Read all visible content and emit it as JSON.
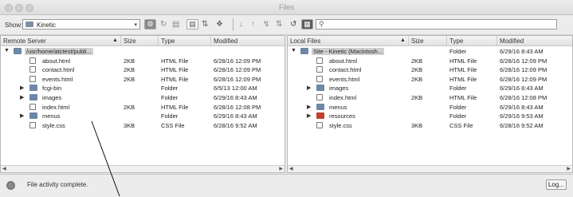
{
  "window": {
    "title": "Files"
  },
  "toolbar": {
    "show_label": "Show:",
    "site_value": "Kinetic",
    "search_value": ""
  },
  "left_pane": {
    "headers": {
      "name": "Remote Server",
      "size": "Size",
      "type": "Type",
      "modified": "Modified"
    },
    "rows": [
      {
        "name": "/usr/home/atctest/publi...",
        "size": "",
        "type": "",
        "modified": "",
        "kind": "folder",
        "level": 0,
        "expanded": true,
        "selected": true
      },
      {
        "name": "about.html",
        "size": "2KB",
        "type": "HTML File",
        "modified": "6/28/16 12:09 PM",
        "kind": "file",
        "level": 1
      },
      {
        "name": "contact.html",
        "size": "2KB",
        "type": "HTML File",
        "modified": "6/28/16 12:09 PM",
        "kind": "file",
        "level": 1
      },
      {
        "name": "events.html",
        "size": "2KB",
        "type": "HTML File",
        "modified": "6/28/16 12:09 PM",
        "kind": "file",
        "level": 1
      },
      {
        "name": "fcgi-bin",
        "size": "",
        "type": "Folder",
        "modified": "6/5/13 12:00 AM",
        "kind": "folder",
        "level": 1,
        "expanded": false
      },
      {
        "name": "images",
        "size": "",
        "type": "Folder",
        "modified": "6/29/16 8:43 AM",
        "kind": "folder",
        "level": 1,
        "expanded": false
      },
      {
        "name": "index.html",
        "size": "2KB",
        "type": "HTML File",
        "modified": "6/28/16 12:08 PM",
        "kind": "file",
        "level": 1
      },
      {
        "name": "menus",
        "size": "",
        "type": "Folder",
        "modified": "6/29/16 8:43 AM",
        "kind": "folder",
        "level": 1,
        "expanded": false
      },
      {
        "name": "style.css",
        "size": "3KB",
        "type": "CSS File",
        "modified": "6/28/16 9:52 AM",
        "kind": "file",
        "level": 1
      }
    ]
  },
  "right_pane": {
    "headers": {
      "name": "Local Files",
      "size": "Size",
      "type": "Type",
      "modified": "Modified"
    },
    "rows": [
      {
        "name": "Site - Kinetic (Macintosh...",
        "size": "",
        "type": "Folder",
        "modified": "6/29/16 8:43 AM",
        "kind": "folder",
        "level": 0,
        "expanded": true,
        "selected": true
      },
      {
        "name": "about.html",
        "size": "2KB",
        "type": "HTML File",
        "modified": "6/28/16 12:09 PM",
        "kind": "file",
        "level": 1
      },
      {
        "name": "contact.html",
        "size": "2KB",
        "type": "HTML File",
        "modified": "6/28/16 12:09 PM",
        "kind": "file",
        "level": 1
      },
      {
        "name": "events.html",
        "size": "2KB",
        "type": "HTML File",
        "modified": "6/28/16 12:09 PM",
        "kind": "file",
        "level": 1
      },
      {
        "name": "images",
        "size": "",
        "type": "Folder",
        "modified": "6/29/16 8:43 AM",
        "kind": "folder",
        "level": 1,
        "expanded": false
      },
      {
        "name": "index.html",
        "size": "2KB",
        "type": "HTML File",
        "modified": "6/28/16 12:08 PM",
        "kind": "file",
        "level": 1
      },
      {
        "name": "menus",
        "size": "",
        "type": "Folder",
        "modified": "6/29/16 8:43 AM",
        "kind": "folder",
        "level": 1,
        "expanded": false
      },
      {
        "name": "resources",
        "size": "",
        "type": "Folder",
        "modified": "6/29/16 9:53 AM",
        "kind": "folder-red",
        "level": 1,
        "expanded": false
      },
      {
        "name": "style.css",
        "size": "3KB",
        "type": "CSS File",
        "modified": "6/28/16 9:52 AM",
        "kind": "file",
        "level": 1
      }
    ]
  },
  "status": {
    "message": "File activity complete.",
    "log_label": "Log..."
  }
}
